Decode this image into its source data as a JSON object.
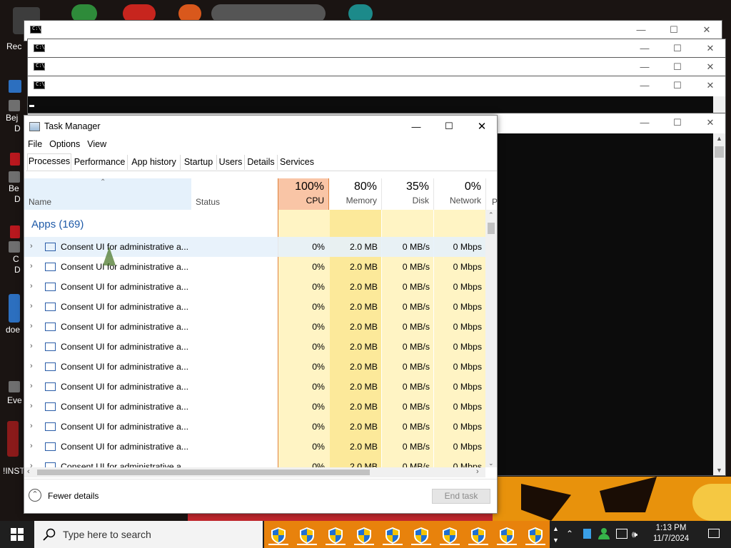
{
  "desktop": {
    "labels": [
      "Rec",
      "Bej",
      "D",
      "Be",
      "D",
      "C",
      "D",
      "doe",
      "Eve",
      "!INST"
    ]
  },
  "console_windows": [
    {
      "name": "console-window-1"
    },
    {
      "name": "console-window-2"
    },
    {
      "name": "console-window-3"
    },
    {
      "name": "console-window-4"
    },
    {
      "name": "console-window-5"
    }
  ],
  "task_manager": {
    "title": "Task Manager",
    "menu": [
      "File",
      "Options",
      "View"
    ],
    "tabs": [
      "Processes",
      "Performance",
      "App history",
      "Startup",
      "Users",
      "Details",
      "Services"
    ],
    "active_tab": "Processes",
    "columns": {
      "name": "Name",
      "status": "Status",
      "cpu": {
        "pct": "100%",
        "label": "CPU"
      },
      "memory": {
        "pct": "80%",
        "label": "Memory"
      },
      "disk": {
        "pct": "35%",
        "label": "Disk"
      },
      "network": {
        "pct": "0%",
        "label": "Network"
      },
      "power": "P"
    },
    "group": "Apps (169)",
    "rows": [
      {
        "name": "Consent UI for administrative a...",
        "cpu": "0%",
        "memory": "2.0 MB",
        "disk": "0 MB/s",
        "network": "0 Mbps"
      },
      {
        "name": "Consent UI for administrative a...",
        "cpu": "0%",
        "memory": "2.0 MB",
        "disk": "0 MB/s",
        "network": "0 Mbps"
      },
      {
        "name": "Consent UI for administrative a...",
        "cpu": "0%",
        "memory": "2.0 MB",
        "disk": "0 MB/s",
        "network": "0 Mbps"
      },
      {
        "name": "Consent UI for administrative a...",
        "cpu": "0%",
        "memory": "2.0 MB",
        "disk": "0 MB/s",
        "network": "0 Mbps"
      },
      {
        "name": "Consent UI for administrative a...",
        "cpu": "0%",
        "memory": "2.0 MB",
        "disk": "0 MB/s",
        "network": "0 Mbps"
      },
      {
        "name": "Consent UI for administrative a...",
        "cpu": "0%",
        "memory": "2.0 MB",
        "disk": "0 MB/s",
        "network": "0 Mbps"
      },
      {
        "name": "Consent UI for administrative a...",
        "cpu": "0%",
        "memory": "2.0 MB",
        "disk": "0 MB/s",
        "network": "0 Mbps"
      },
      {
        "name": "Consent UI for administrative a...",
        "cpu": "0%",
        "memory": "2.0 MB",
        "disk": "0 MB/s",
        "network": "0 Mbps"
      },
      {
        "name": "Consent UI for administrative a...",
        "cpu": "0%",
        "memory": "2.0 MB",
        "disk": "0 MB/s",
        "network": "0 Mbps"
      },
      {
        "name": "Consent UI for administrative a...",
        "cpu": "0%",
        "memory": "2.0 MB",
        "disk": "0 MB/s",
        "network": "0 Mbps"
      },
      {
        "name": "Consent UI for administrative a...",
        "cpu": "0%",
        "memory": "2.0 MB",
        "disk": "0 MB/s",
        "network": "0 Mbps"
      },
      {
        "name": "Consent UI for administrative a...",
        "cpu": "0%",
        "memory": "2.0 MB",
        "disk": "0 MB/s",
        "network": "0 Mbps"
      }
    ],
    "fewer_details": "Fewer details",
    "end_task": "End task"
  },
  "taskbar": {
    "search_placeholder": "Type here to search",
    "time": "1:13 PM",
    "date": "11/7/2024",
    "pinned_count": 10
  },
  "colors": {
    "cpu_header_bg": "#f9c5a6",
    "cpu_header_border": "#e0823c",
    "heat_light": "#fff4c4",
    "heat_mid": "#fce99a",
    "accent_blue": "#1e5aa8",
    "taskbar_bg": "#1f1f1f",
    "search_bg": "#f3f3f3"
  }
}
